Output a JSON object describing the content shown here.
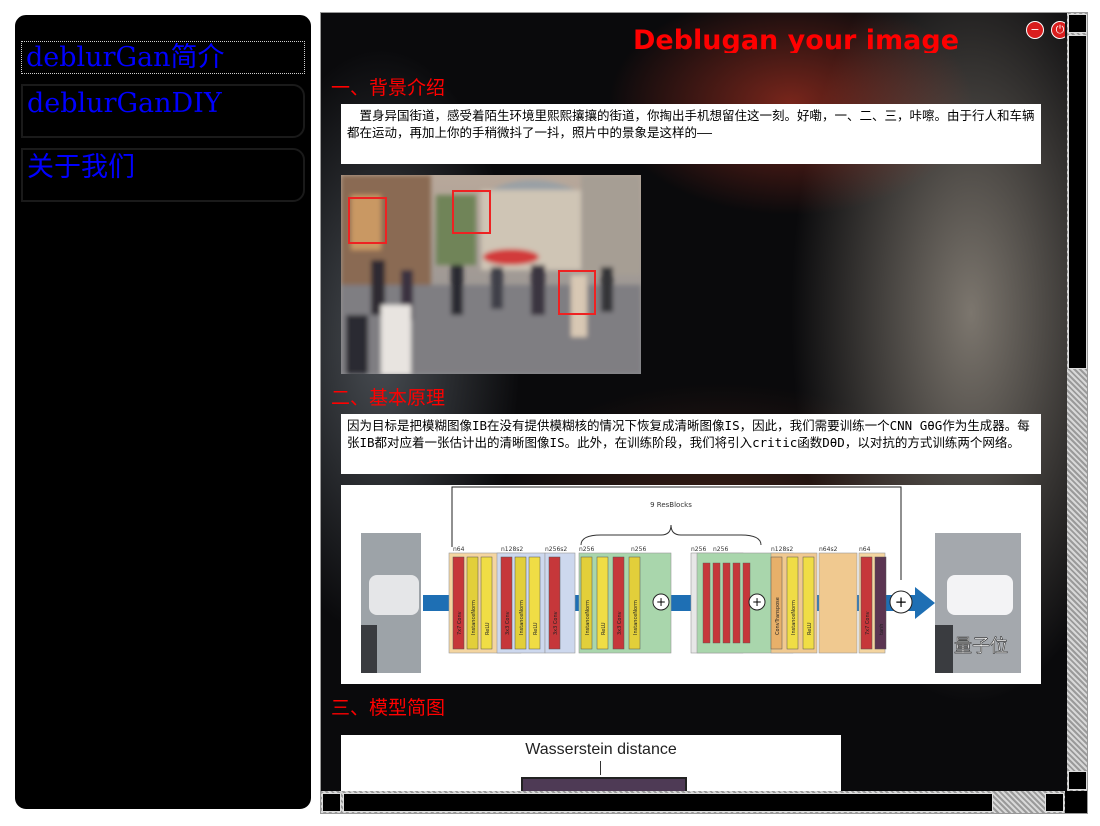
{
  "sidebar": {
    "items": [
      {
        "label": "deblurGan简介"
      },
      {
        "label": "deblurGanDIY"
      },
      {
        "label": "关于我们"
      }
    ]
  },
  "page": {
    "title": "Deblugan your image"
  },
  "sections": [
    {
      "heading": "一、背景介绍",
      "text": "　置身异国街道，感受着陌生环境里熙熙攘攘的街道，你掏出手机想留住这一刻。好嘞，一、二、三，咔嚓。由于行人和车辆都在运动，再加上你的手稍微抖了一抖，照片中的景象是这样的——"
    },
    {
      "heading": "二、基本原理",
      "text": "因为目标是把模糊图像IB在没有提供模糊核的情况下恢复成清晰图像IS，因此，我们需要训练一个CNN GθG作为生成器。每张IB都对应着一张估计出的清晰图像IS。此外，在训练阶段，我们将引入critic函数DθD，以对抗的方式训练两个网络。"
    },
    {
      "heading": "三、模型简图"
    }
  ],
  "architecture": {
    "resblocks_label": "9 ResBlocks",
    "dim_labels": [
      "n64",
      "n128s2",
      "n256s2",
      "n256",
      "n256",
      "n256",
      "n256",
      "n128s2",
      "n64s2",
      "n64"
    ],
    "layers": [
      "7x7 Conv",
      "InstanceNorm",
      "ReLU",
      "3x3 Conv",
      "InstanceNorm",
      "ReLU",
      "3x3 Conv",
      "InstanceNorm",
      "ReLU",
      "3x3 Conv",
      "InstanceNorm",
      "ConvTranspose",
      "InstanceNorm",
      "ReLU",
      "7x7 Conv",
      "tanh"
    ],
    "watermark": "量子位"
  },
  "model_diagram": {
    "label": "Wasserstein distance"
  },
  "window_buttons": [
    "minimize",
    "power"
  ],
  "colors": {
    "heading": "#ff0000",
    "nav_link": "#0000ff",
    "title": "#ff0000"
  }
}
